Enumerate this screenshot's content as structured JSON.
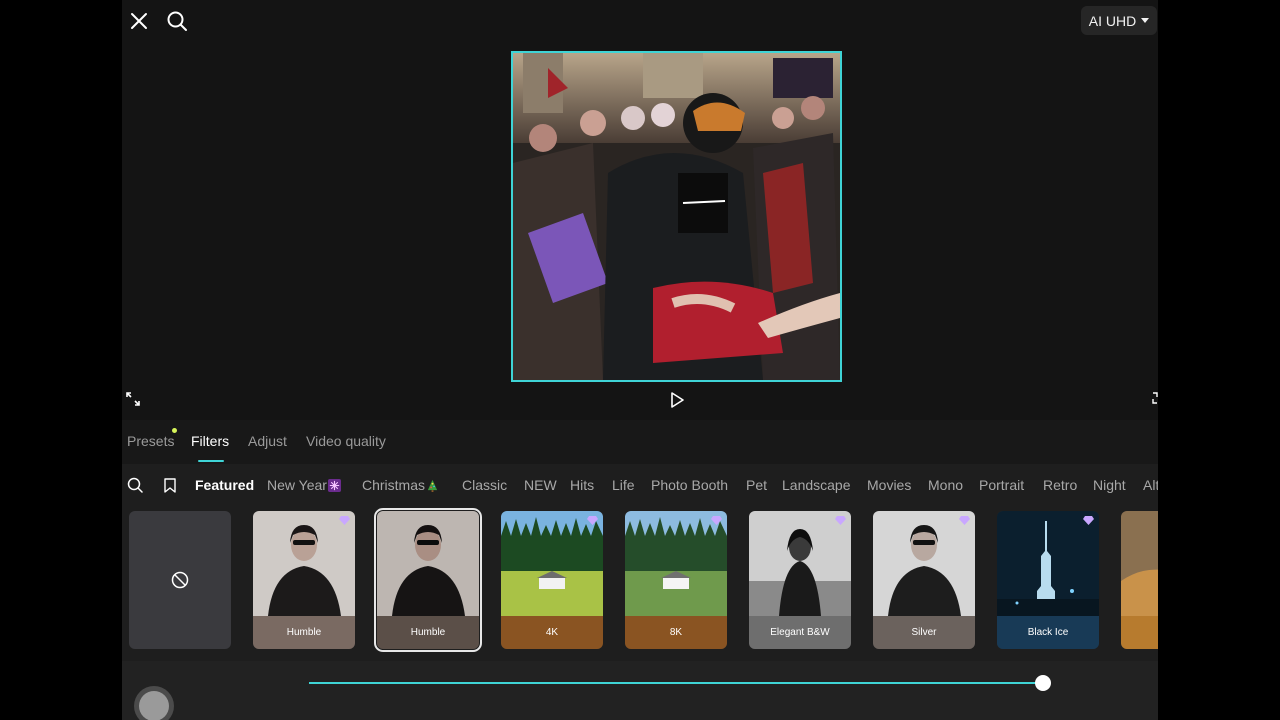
{
  "header": {
    "quality_label": "AI UHD",
    "icons": [
      "close-icon",
      "search-icon",
      "chevron-down-icon"
    ]
  },
  "preview": {
    "accent": "#3fd4d6",
    "icons": [
      "expand-icon",
      "play-icon"
    ]
  },
  "tabs": [
    {
      "label": "Presets",
      "active": false
    },
    {
      "label": "Filters",
      "active": true
    },
    {
      "label": "Adjust",
      "active": false
    },
    {
      "label": "Video quality",
      "active": false
    }
  ],
  "categories": {
    "icons": [
      "search-icon",
      "bookmark-icon"
    ],
    "items": [
      "Featured",
      "New Year",
      "Christmas",
      "Classic",
      "NEW",
      "Hits",
      "Life",
      "Photo Booth",
      "Pet",
      "Landscape",
      "Movies",
      "Mono",
      "Portrait",
      "Retro",
      "Night",
      "Alt"
    ],
    "active": "Featured"
  },
  "filters": [
    {
      "label": "",
      "type": "none",
      "icon": "no-filter-icon"
    },
    {
      "label": "Humble",
      "premium": true,
      "color": "#7a6a62"
    },
    {
      "label": "Humble",
      "premium": false,
      "selected": true,
      "color": "#5b4f48"
    },
    {
      "label": "4K",
      "premium": true,
      "color": "#8a5422"
    },
    {
      "label": "8K",
      "premium": true,
      "color": "#8a5422"
    },
    {
      "label": "Elegant B&W",
      "premium": true,
      "color": "#6e6e6e"
    },
    {
      "label": "Silver",
      "premium": true,
      "color": "#6b625d"
    },
    {
      "label": "Black Ice",
      "premium": true,
      "color": "#183a56"
    }
  ],
  "slider": {
    "value": 1.0
  }
}
